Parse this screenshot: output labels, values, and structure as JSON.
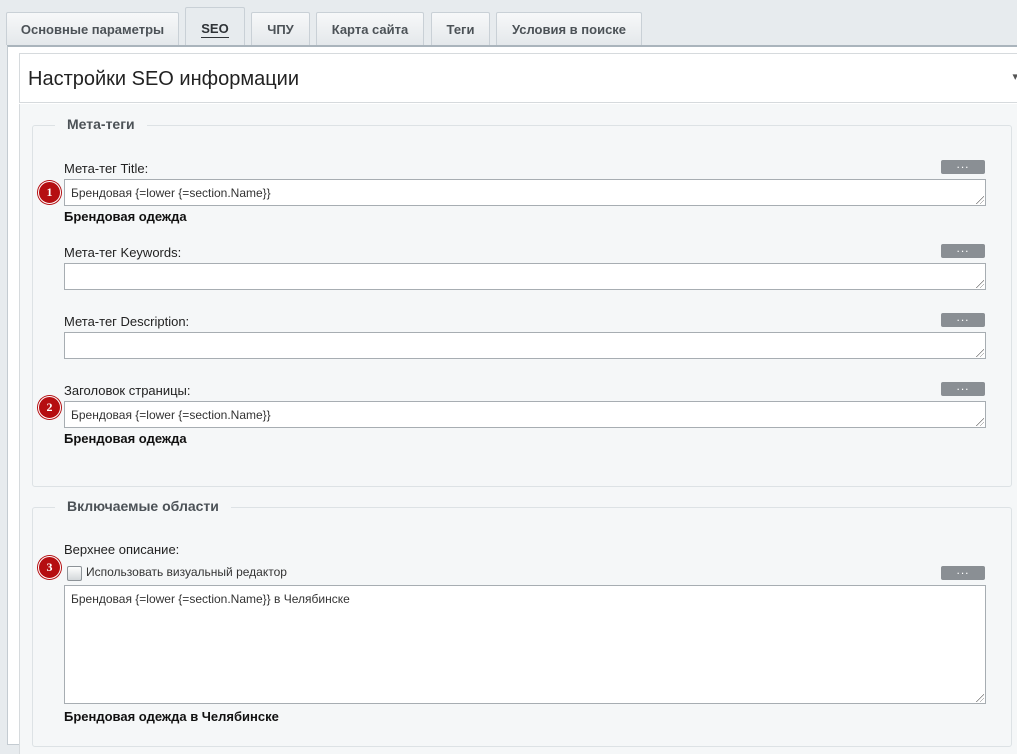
{
  "tabs": [
    {
      "label": "Основные параметры"
    },
    {
      "label": "SEO"
    },
    {
      "label": "ЧПУ"
    },
    {
      "label": "Карта сайта"
    },
    {
      "label": "Теги"
    },
    {
      "label": "Условия в поиске"
    }
  ],
  "active_tab": "SEO",
  "section": {
    "title": "Настройки SEO информации"
  },
  "meta": {
    "legend": "Мета-теги",
    "fields": [
      {
        "label": "Мета-тег Title:",
        "value": "Брендовая {=lower {=section.Name}}",
        "preview": "Брендовая одежда",
        "badge": "1"
      },
      {
        "label": "Мета-тег Keywords:",
        "value": "",
        "preview": ""
      },
      {
        "label": "Мета-тег Description:",
        "value": "",
        "preview": ""
      },
      {
        "label": "Заголовок страницы:",
        "value": "Брендовая {=lower {=section.Name}}",
        "preview": "Брендовая одежда",
        "badge": "2"
      }
    ]
  },
  "include": {
    "legend": "Включаемые области",
    "top_description": {
      "label": "Верхнее описание:",
      "badge": "3",
      "checkbox_label": "Использовать визуальный редактор",
      "checkbox_checked": false,
      "value": "Брендовая {=lower {=section.Name}} в Челябинске",
      "preview": "Брендовая одежда в Челябинске"
    }
  },
  "dots_label": "...",
  "colors": {
    "badge": "#b50e11",
    "dots_button": "#8a8f94"
  }
}
